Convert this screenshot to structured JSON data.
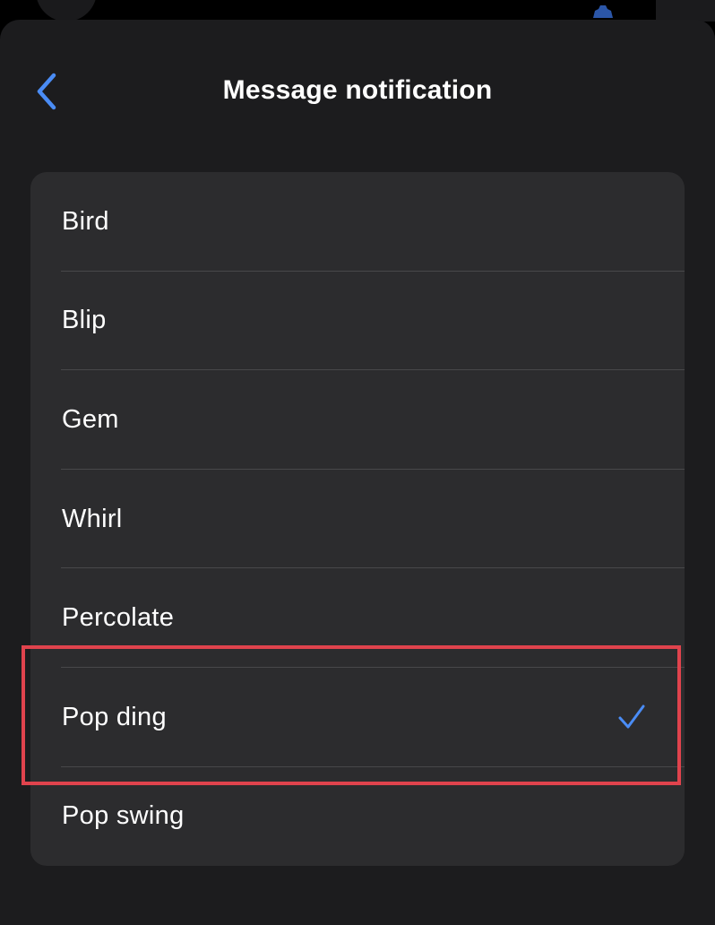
{
  "header": {
    "title": "Message notification",
    "back_icon": "chevron-left-icon"
  },
  "sounds": {
    "items": [
      {
        "label": "Bird",
        "selected": false
      },
      {
        "label": "Blip",
        "selected": false
      },
      {
        "label": "Gem",
        "selected": false
      },
      {
        "label": "Whirl",
        "selected": false
      },
      {
        "label": "Percolate",
        "selected": false
      },
      {
        "label": "Pop ding",
        "selected": true
      },
      {
        "label": "Pop swing",
        "selected": false
      }
    ],
    "selected_icon": "checkmark-icon"
  },
  "colors": {
    "accent": "#4a8cf5",
    "highlight": "#e0434d",
    "sheet_background": "#1c1c1e",
    "card_background": "#2c2c2e"
  }
}
